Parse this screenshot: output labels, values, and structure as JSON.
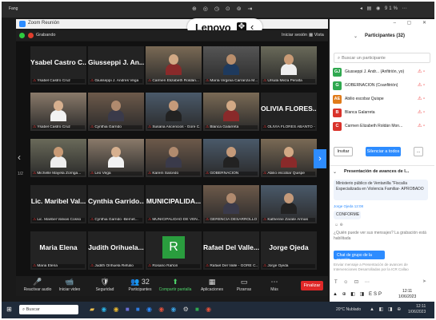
{
  "tablet": {
    "title": "Fang",
    "status_mid": "⊕ ◎ ◷ ⊙ ⊚ ⇥",
    "status_right": "◂ ▤ ◉ 91% ⋯"
  },
  "lenovo": {
    "brand": "Lenovo",
    "chevron": "‹"
  },
  "zoom": {
    "window_title": "Zoom Reunión",
    "recording_label": "Grabando",
    "signin_label": "Iniciar sesión",
    "view_label": "Vista"
  },
  "tiles": [
    {
      "type": "name",
      "big": "Ysabel Castro C...",
      "cap": "Ysabel Castro Cruz"
    },
    {
      "type": "name",
      "big": "Giusseppi J. An...",
      "cap": "Giusseppi J. Andres Vega"
    },
    {
      "type": "video",
      "cap": "Carmen Elizabeth Roldán..."
    },
    {
      "type": "video",
      "cap": "María Virginia Carranza M..."
    },
    {
      "type": "video",
      "cap": "Ursula Meza Peralta"
    },
    {
      "type": "video",
      "cap": "Ysabel Castro Cruz"
    },
    {
      "type": "video",
      "cap": "Cynthia Garrido"
    },
    {
      "type": "video",
      "cap": "Susana Ascencios - Gore C...",
      "active": true
    },
    {
      "type": "video",
      "cap": "Blanca Galarreta"
    },
    {
      "type": "name",
      "big": "OLIVIA FLORES...",
      "cap": "OLIVIA FLORES ABANTO -..."
    },
    {
      "type": "video",
      "cap": "Michelle Mayela Zorriga..."
    },
    {
      "type": "video",
      "cap": "Leo Vega"
    },
    {
      "type": "video",
      "cap": "Karem Salcedo"
    },
    {
      "type": "video",
      "cap": "GOBERNACIÓN"
    },
    {
      "type": "video",
      "cap": "Abilio escobar Quispe"
    },
    {
      "type": "name",
      "big": "Lic. Maribel Val...",
      "cap": "Lic. Maribel Valvas Cosso"
    },
    {
      "type": "name",
      "big": "Cynthia Garrido...",
      "cap": "Cynthia Garrido -Bemet..."
    },
    {
      "type": "name",
      "big": "MUNICIPALIDA...",
      "cap": "MUNICIPALIDAD DE VEN..."
    },
    {
      "type": "video",
      "cap": "GERENCIA DESARROLLO ..."
    },
    {
      "type": "video",
      "cap": "Katherine Zarate Armas"
    },
    {
      "type": "name",
      "big": "Maria Elena",
      "cap": "Maria Elena"
    },
    {
      "type": "name",
      "big": "Judith Orihuela...",
      "cap": "Judith Orihuela Refulio"
    },
    {
      "type": "avatar",
      "big": "R",
      "cap": "Rosario Rañon"
    },
    {
      "type": "name",
      "big": "Rafael Del Valle...",
      "cap": "Rafael Del Valle - GORE C..."
    },
    {
      "type": "name",
      "big": "Jorge Ojeda",
      "cap": "Jorge Ojeda"
    }
  ],
  "gallery_nav": {
    "left": "‹",
    "left_page": "1/2",
    "right": "›"
  },
  "toolbar": {
    "items": [
      {
        "icon": "🎤",
        "label": "Reactivar audio"
      },
      {
        "icon": "📹",
        "label": "Iniciar video"
      },
      {
        "icon": "🛡",
        "label": "Seguridad"
      },
      {
        "icon": "👥 32",
        "label": "Participantes"
      },
      {
        "icon": "⬆",
        "label": "Compartir pantalla",
        "green": true
      },
      {
        "icon": "▦",
        "label": "Aplicaciones"
      },
      {
        "icon": "▭",
        "label": "Pizarras"
      },
      {
        "icon": "⋯",
        "label": "Más"
      }
    ],
    "end_label": "Finalizar"
  },
  "panel": {
    "window_controls": "– ▢ ✕",
    "title": "Participantes (32)",
    "search_placeholder": "Buscar un participante",
    "participants": [
      {
        "initial": "GJ",
        "name": "Giusseppi J. Andr... (Anfitrión, yo)",
        "color": "#2fa84f"
      },
      {
        "initial": "G",
        "name": "GOBERNACION (Coanfitrión)",
        "color": "#2fa84f"
      },
      {
        "initial": "AE",
        "name": "Abilio escobar Quispe",
        "color": "#e07b1a"
      },
      {
        "initial": "B",
        "name": "Blanca Galarreta",
        "color": "#d9332b"
      },
      {
        "initial": "C",
        "name": "Carmen Elizabeth Roldán Mon...",
        "color": "#d9332b"
      }
    ],
    "invite_label": "Invitar",
    "mute_all_label": "Silenciar a todos",
    "more_label": "...",
    "chat_title": "Presentación de avances de l...",
    "chat_msg1": "Ministerio público de Ventanilla \"Fiscalía Especializada en Violencia Familiar- APROBADO",
    "chat_from": "Jorge Ojeda 12:08",
    "chat_msg2": "CONFORME",
    "chat_react": "☺ ⊕",
    "chat_info": "¿Quién puede ver sus mensajes? La grabación está habilitada",
    "chat_to": "Chat de grupo de la reunión ⌄",
    "chat_hint": "Enviar mensaje a Presentación de avances de Intervenciones Desarrolladas por la ICR Callao",
    "chat_tools": "T ☺ ⊡ ⋯",
    "chat_send": "➤",
    "tray_icons": "▲ ⊕ ◧ ◨ ESP",
    "tray_time": "12:11",
    "tray_date": "1/06/2023"
  },
  "taskbar": {
    "start": "⊞",
    "search_label": "Buscar",
    "weather": "20°C Nublado",
    "tray_icons": "▲ ◧ ◨ ⊕",
    "time": "12:11",
    "date": "1/06/2023"
  }
}
